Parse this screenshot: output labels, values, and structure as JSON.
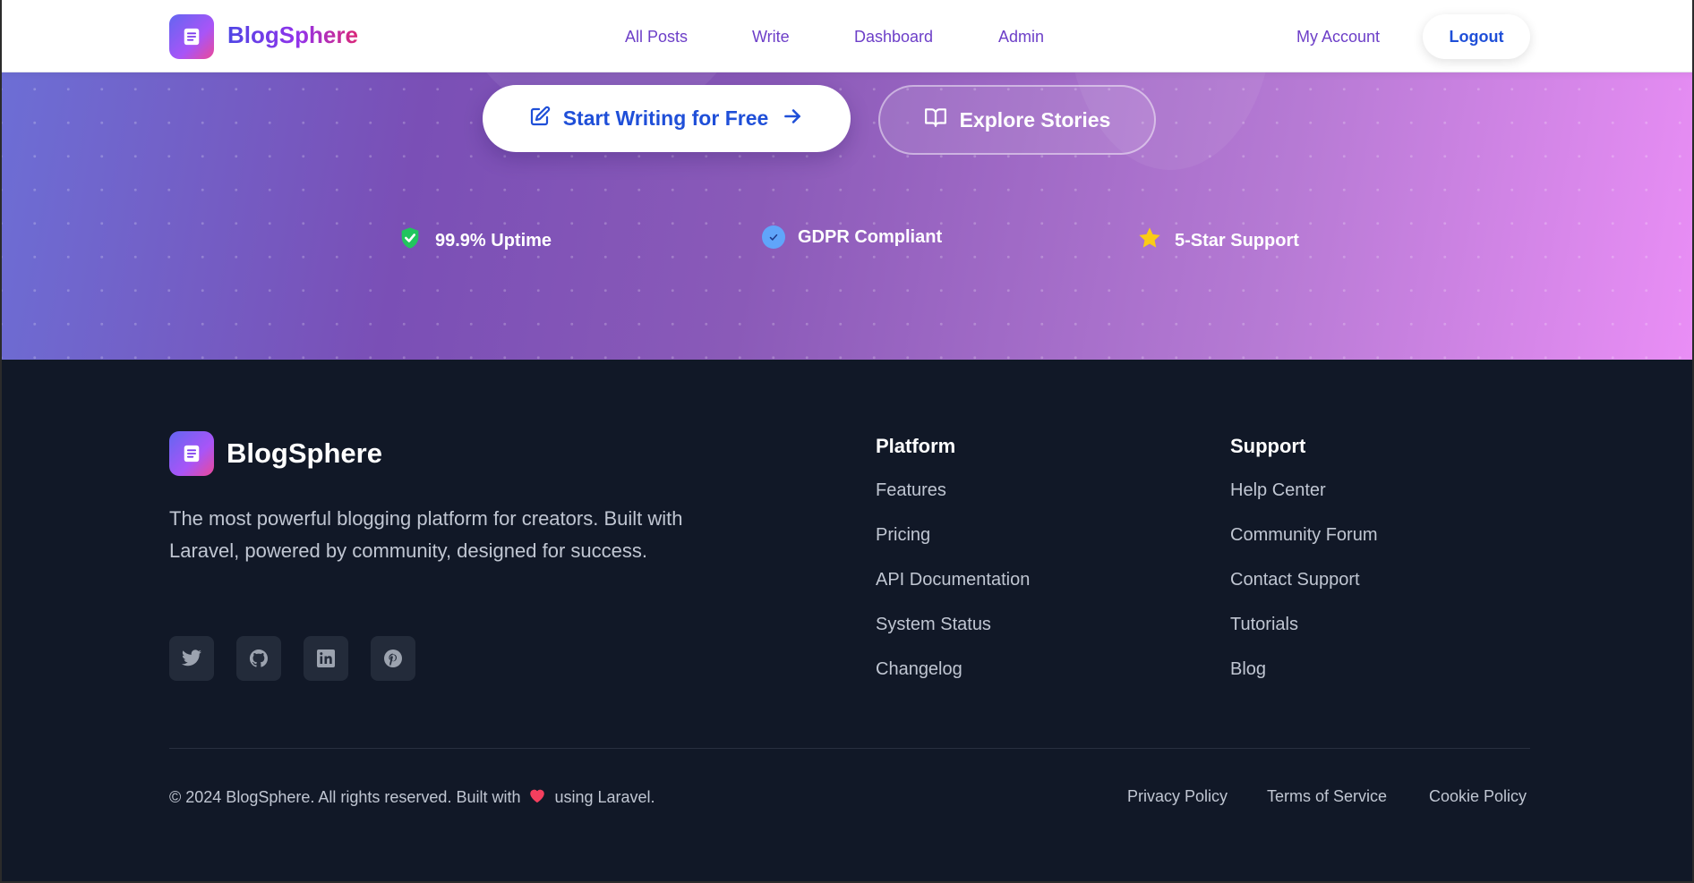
{
  "nav": {
    "brand": "BlogSphere",
    "links": [
      "All Posts",
      "Write",
      "Dashboard",
      "Admin"
    ],
    "account": "My Account",
    "logout": "Logout"
  },
  "hero": {
    "primary_cta": "Start Writing for Free",
    "secondary_cta": "Explore Stories",
    "badges": [
      {
        "label": "99.9% Uptime",
        "icon": "shield-check-icon",
        "color": "#22c55e"
      },
      {
        "label": "GDPR Compliant",
        "icon": "verified-badge-icon",
        "color": "#60a5fa"
      },
      {
        "label": "5-Star Support",
        "icon": "star-icon",
        "color": "#facc15"
      }
    ]
  },
  "footer": {
    "brand": "BlogSphere",
    "description": "The most powerful blogging platform for creators. Built with Laravel, powered by community, designed for success.",
    "socials": [
      "twitter-icon",
      "github-icon",
      "linkedin-icon",
      "pinterest-icon"
    ],
    "platform": {
      "title": "Platform",
      "links": [
        "Features",
        "Pricing",
        "API Documentation",
        "System Status",
        "Changelog"
      ]
    },
    "support": {
      "title": "Support",
      "links": [
        "Help Center",
        "Community Forum",
        "Contact Support",
        "Tutorials",
        "Blog"
      ]
    },
    "copyright_pre": "© 2024 BlogSphere. All rights reserved. Built with",
    "copyright_post": "using Laravel.",
    "legal": [
      "Privacy Policy",
      "Terms of Service",
      "Cookie Policy"
    ]
  },
  "colors": {
    "accent_blue": "#1f4fd8",
    "nav_link": "#6d3fc8",
    "footer_bg": "#111827",
    "heart": "#f43f5e"
  }
}
